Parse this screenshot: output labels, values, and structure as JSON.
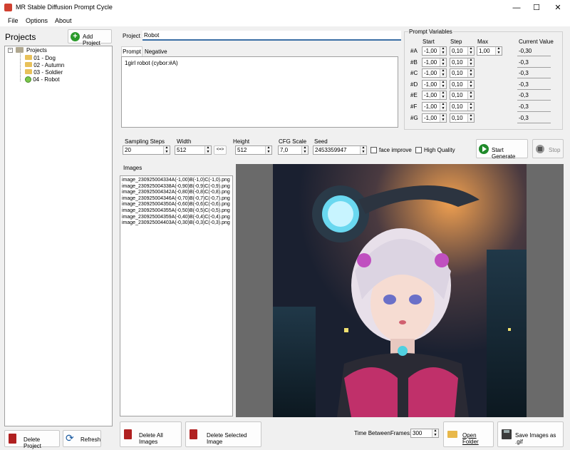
{
  "window": {
    "title": "MR Stable Diffusion Prompt Cycle",
    "minimize": "—",
    "maximize": "☐",
    "close": "✕"
  },
  "menu": {
    "file": "File",
    "options": "Options",
    "about": "About"
  },
  "left": {
    "title": "Projects",
    "add_button": "Add Project",
    "tree_root": "Projects",
    "projects": [
      "01 - Dog",
      "02 - Autumn",
      "03 - Soldier",
      "04 - Robot"
    ],
    "delete_button": "Delete Project",
    "refresh_button": "Refresh"
  },
  "project": {
    "label": "Project :",
    "value": "Robot"
  },
  "tabs": {
    "prompt": "Prompt",
    "negative": "Negative"
  },
  "prompt_text": "1girl robot (cybor:#A)",
  "variables": {
    "title": "Prompt Variables",
    "headers": {
      "start": "Start",
      "step": "Step",
      "max": "Max",
      "current": "Current Value"
    },
    "rows": [
      {
        "name": "#A",
        "start": "-1,00",
        "step": "0,10",
        "max": "1,00",
        "current": "-0,30"
      },
      {
        "name": "#B",
        "start": "-1,00",
        "step": "0,10",
        "current": "-0,3"
      },
      {
        "name": "#C",
        "start": "-1,00",
        "step": "0,10",
        "current": "-0,3"
      },
      {
        "name": "#D",
        "start": "-1,00",
        "step": "0,10",
        "current": "-0,3"
      },
      {
        "name": "#E",
        "start": "-1,00",
        "step": "0,10",
        "current": "-0,3"
      },
      {
        "name": "#F",
        "start": "-1,00",
        "step": "0,10",
        "current": "-0,3"
      },
      {
        "name": "#G",
        "start": "-1,00",
        "step": "0,10",
        "current": "-0,3"
      }
    ]
  },
  "settings": {
    "sampling_label": "Sampling Steps",
    "sampling": "20",
    "width_label": "Width",
    "width": "512",
    "swap": "<=>",
    "height_label": "Height",
    "height": "512",
    "cfg_label": "CFG Scale",
    "cfg": "7,0",
    "seed_label": "Seed",
    "seed": "2453359947",
    "face_improve": "face improve",
    "high_quality": "High Quality"
  },
  "actions": {
    "start": "Start Generate",
    "stop": "Stop"
  },
  "images": {
    "label": "Images",
    "files": [
      "image_230925004334A(-1,00)B(-1,0)C(-1,0).png",
      "image_230925004338A(-0,90)B(-0,9)C(-0,9).png",
      "image_230925004342A(-0,80)B(-0,8)C(-0,8).png",
      "image_230925004346A(-0,70)B(-0,7)C(-0,7).png",
      "image_230925004350A(-0,60)B(-0,6)C(-0,6).png",
      "image_230925004355A(-0,50)B(-0,5)C(-0,5).png",
      "image_230925004359A(-0,40)B(-0,4)C(-0,4).png",
      "image_230925004403A(-0,30)B(-0,3)C(-0,3).png"
    ]
  },
  "bottom": {
    "delete_all": "Delete All Images",
    "delete_selected": "Delete Selected Image",
    "time_label": "Time BetweenFrames:",
    "time_value": "300",
    "open_folder": "Open Folder",
    "save_gif": "Save Images as .gif"
  }
}
